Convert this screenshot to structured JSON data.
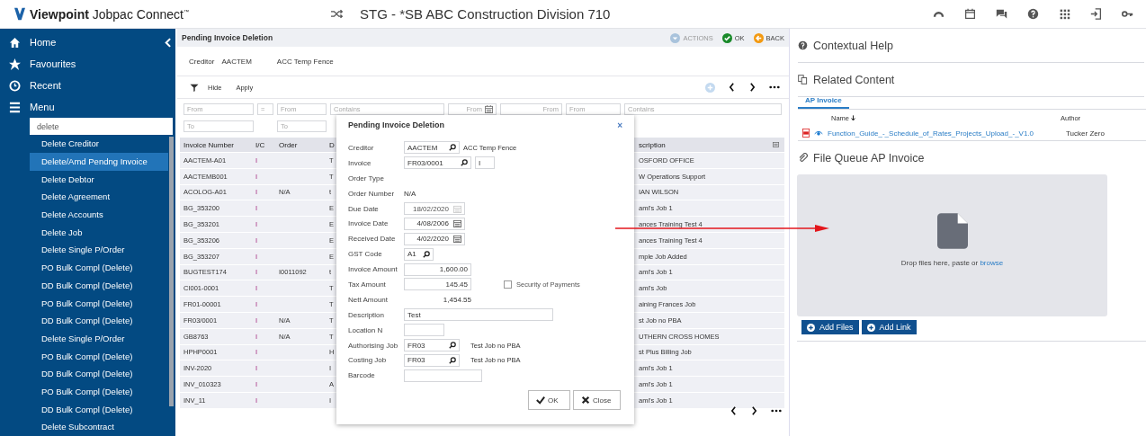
{
  "app": {
    "brand": "Viewpoint",
    "product": "Jobpac Connect",
    "trademark": "™",
    "company": "STG - *SB ABC Construction Division 710"
  },
  "sidebar": {
    "nav": [
      {
        "label": "Home"
      },
      {
        "label": "Favourites"
      },
      {
        "label": "Recent"
      },
      {
        "label": "Menu"
      }
    ],
    "search": {
      "value": "delete"
    },
    "items": [
      {
        "label": "Delete Creditor",
        "selected": false
      },
      {
        "label": "Delete/Amd Pendng Invoice",
        "selected": true
      },
      {
        "label": "Delete Debtor",
        "selected": false
      },
      {
        "label": "Delete Agreement",
        "selected": false
      },
      {
        "label": "Delete Accounts",
        "selected": false
      },
      {
        "label": "Delete Job",
        "selected": false
      },
      {
        "label": "Delete Single P/Order",
        "selected": false
      },
      {
        "label": "PO Bulk Compl (Delete)",
        "selected": false
      },
      {
        "label": "DD Bulk Compl (Delete)",
        "selected": false
      },
      {
        "label": "PO Bulk Compl (Delete)",
        "selected": false
      },
      {
        "label": "DD Bulk Compl (Delete)",
        "selected": false
      },
      {
        "label": "Delete Single P/Order",
        "selected": false
      },
      {
        "label": "PO Bulk Compl (Delete)",
        "selected": false
      },
      {
        "label": "DD Bulk Compl (Delete)",
        "selected": false
      },
      {
        "label": "PO Bulk Compl (Delete)",
        "selected": false
      },
      {
        "label": "DD Bulk Compl (Delete)",
        "selected": false
      },
      {
        "label": "Delete Subcontract",
        "selected": false
      }
    ]
  },
  "page": {
    "title": "Pending Invoice Deletion",
    "actions": [
      {
        "label": "ACTIONS",
        "disabled": true
      },
      {
        "label": "OK",
        "disabled": false
      },
      {
        "label": "BACK",
        "disabled": false
      }
    ],
    "creditor": {
      "label": "Creditor",
      "code": "AACTEM",
      "name": "ACC Temp Fence"
    },
    "toolbar": [
      {
        "label": "Hide"
      },
      {
        "label": "Apply"
      }
    ],
    "filters_from": [
      "From",
      "=",
      "From",
      "Contains",
      "From",
      "From",
      "From",
      "Contains"
    ],
    "filters_to": [
      "To",
      "To"
    ],
    "table": {
      "columns": [
        "Invoice Number",
        "I/C",
        "Order",
        "D",
        "scription"
      ],
      "rows": [
        [
          "AACTEM-A01",
          "I",
          "",
          "T",
          "OSFORD OFFICE"
        ],
        [
          "AACTEMB001",
          "I",
          "",
          "T",
          "W Operations Support"
        ],
        [
          "ACOLOG-A01",
          "I",
          "N/A",
          "t",
          "IAN WILSON"
        ],
        [
          "BG_353200",
          "I",
          "",
          "E",
          "ami's Job 1"
        ],
        [
          "BG_353201",
          "I",
          "",
          "E",
          "ances Training Test 4"
        ],
        [
          "BG_353206",
          "I",
          "",
          "E",
          "ances Training Test 4"
        ],
        [
          "BG_353207",
          "I",
          "",
          "E",
          "mple Job Added"
        ],
        [
          "BUGTEST174",
          "I",
          "I0011092",
          "t",
          "ami's Job 1"
        ],
        [
          "CI001-0001",
          "I",
          "",
          "T",
          "ami's Job"
        ],
        [
          "FR01-00001",
          "I",
          "",
          "T",
          "aining Frances Job"
        ],
        [
          "FR03/0001",
          "I",
          "N/A",
          "T",
          "st Job no PBA"
        ],
        [
          "GB8763",
          "I",
          "N/A",
          "T",
          "UTHERN CROSS HOMES"
        ],
        [
          "HPHP0001",
          "I",
          "",
          "H",
          "st Plus Billing Job"
        ],
        [
          "INV-2020",
          "I",
          "",
          "I",
          "ami's Job 1"
        ],
        [
          "INV_010323",
          "I",
          "",
          "A",
          "ami's Job 1"
        ],
        [
          "INV_11",
          "I",
          "",
          "I",
          "ami's Job 1"
        ]
      ]
    }
  },
  "dialog": {
    "title": "Pending Invoice Deletion",
    "close": "×",
    "fields": [
      {
        "kind": "lookup",
        "label": "Creditor",
        "value": "AACTEM",
        "note": "ACC Temp Fence"
      },
      {
        "kind": "lookup",
        "label": "Invoice",
        "value": "FR03/0001",
        "suffix": "I"
      },
      {
        "kind": "readonly",
        "label": "Order Type"
      },
      {
        "kind": "readonly",
        "label": "Order Number",
        "value": "N/A"
      },
      {
        "kind": "date",
        "label": "Due Date",
        "value": "18/02/2020",
        "disabled": true
      },
      {
        "kind": "date",
        "label": "Invoice Date",
        "value": "4/08/2006",
        "disabled": false
      },
      {
        "kind": "date",
        "label": "Received Date",
        "value": "4/02/2020",
        "disabled": false
      },
      {
        "kind": "code",
        "label": "GST Code",
        "value": "A1"
      },
      {
        "kind": "amount",
        "label": "Invoice Amount",
        "value": "1,600.00"
      },
      {
        "kind": "amount",
        "label": "Tax Amount",
        "value": "145.45",
        "checkbox": {
          "label": "Security of Payments",
          "checked": false
        }
      },
      {
        "kind": "total",
        "label": "Nett Amount",
        "value": "1,454.55"
      },
      {
        "kind": "wide",
        "label": "Description",
        "value": "Test"
      },
      {
        "kind": "short",
        "label": "Location N"
      },
      {
        "kind": "lookup",
        "label": "Authorising Job",
        "value": "FR03",
        "note": "Test Job no PBA"
      },
      {
        "kind": "lookup",
        "label": "Costing Job",
        "value": "FR03",
        "note": "Test Job no PBA"
      },
      {
        "kind": "text",
        "label": "Barcode"
      }
    ],
    "buttons": [
      {
        "kind": "ok",
        "label": "OK"
      },
      {
        "kind": "close",
        "label": "Close"
      }
    ]
  },
  "help": {
    "contextual": "Contextual Help",
    "related": "Related Content",
    "tabs": [
      {
        "label": "AP Invoice",
        "selected": true
      }
    ],
    "columns": [
      "Name",
      "Author"
    ],
    "documents": [
      {
        "name": "Function_Guide_-_Schedule_of_Rates_Projects_Upload_-_V1.0",
        "author": "Tucker Zero"
      }
    ],
    "queue": {
      "title": "File Queue AP Invoice",
      "drop_text": "Drop files here, paste or",
      "browse": "browse",
      "buttons": [
        "Add Files",
        "Add Link"
      ]
    }
  }
}
